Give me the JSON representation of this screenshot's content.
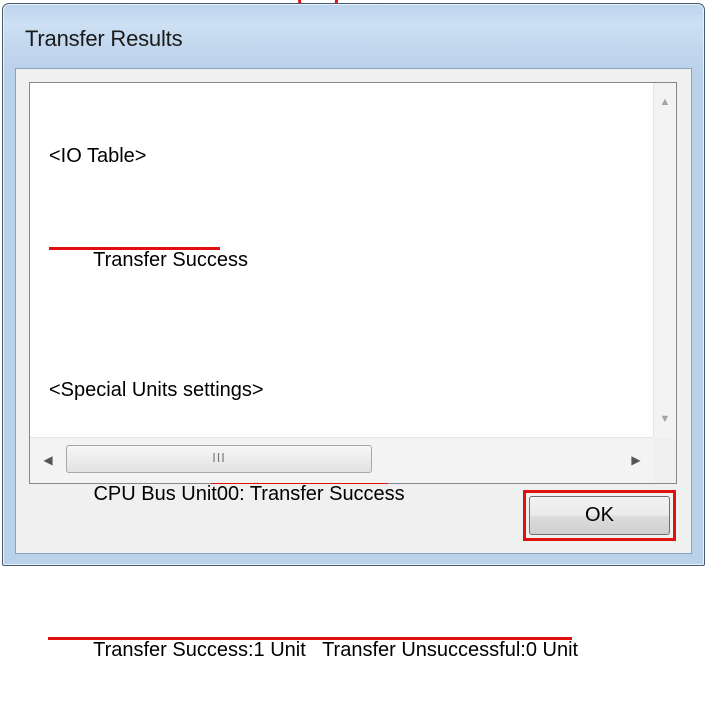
{
  "window": {
    "title": "Transfer Results"
  },
  "results": {
    "lines": [
      "<IO Table>",
      "Transfer Success",
      "",
      "<Special Units settings>",
      "CPU Bus Unit00: Transfer Success",
      "",
      "Transfer Success:1 Unit   Transfer Unsuccessful:0 Unit"
    ]
  },
  "scrollbars": {
    "vertical_up_icon": "arrow-up-icon",
    "vertical_down_icon": "arrow-down-icon",
    "horizontal_left_icon": "arrow-left-icon",
    "horizontal_right_icon": "arrow-right-icon",
    "grip": "III"
  },
  "buttons": {
    "ok_label": "OK"
  },
  "annotations": {
    "highlight_color": "#e01010"
  }
}
